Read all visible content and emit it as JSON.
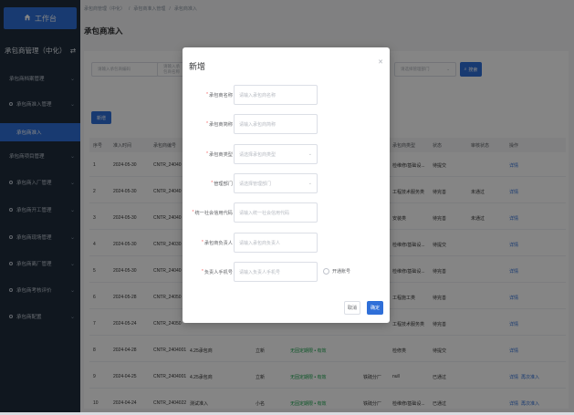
{
  "sidebar": {
    "home_icon": "home-icon",
    "home_label": "工作台",
    "section_title": "承包商管理（中化）",
    "section_toggle": "⇄",
    "items": [
      {
        "label": "承包商档案管理",
        "has_dot": false
      },
      {
        "label": "承包商准入管理",
        "has_dot": true
      },
      {
        "label": "承包商项目管理",
        "has_dot": false
      },
      {
        "label": "承包商入厂管理",
        "has_dot": true
      },
      {
        "label": "承包商开工管理",
        "has_dot": true
      },
      {
        "label": "承包商现场管理",
        "has_dot": true
      },
      {
        "label": "承包商离厂管理",
        "has_dot": true
      },
      {
        "label": "承包商考核评价",
        "has_dot": true
      },
      {
        "label": "承包商配置",
        "has_dot": true
      }
    ],
    "active_sub": "承包商准入"
  },
  "main": {
    "breadcrumb": [
      "承包商管理（中化）",
      "/",
      "承包商准入管理",
      "/",
      "承包商准入"
    ],
    "title": "承包商准入",
    "filters": {
      "code_placeholder": "请输入承包商编码",
      "name_placeholder": "请输入承包商名称",
      "dept_placeholder": "请选择管理部门",
      "search_label": "搜索"
    },
    "add_label": "新增",
    "table": {
      "headers": [
        "序号",
        "准入时间",
        "承包商编号",
        "",
        "",
        "",
        "",
        "承包商类型",
        "状态",
        "审核状态",
        "操作"
      ],
      "rows": [
        {
          "no": "1",
          "date": "2024-05-30",
          "code": "CNTR_24040",
          "name": "",
          "person": "",
          "contact": "",
          "dept": "",
          "type": "检维修/基础设...",
          "status": "待提交",
          "audit": "",
          "ops": [
            "详情"
          ]
        },
        {
          "no": "2",
          "date": "2024-05-30",
          "code": "CNTR_24040",
          "name": "",
          "person": "",
          "contact": "",
          "dept": "",
          "type": "工程技术服务类",
          "status": "待完善",
          "audit": "未通过",
          "ops": [
            "详情"
          ]
        },
        {
          "no": "3",
          "date": "2024-05-30",
          "code": "CNTR_24040",
          "name": "",
          "person": "",
          "contact": "",
          "dept": "",
          "type": "安装类",
          "status": "待完善",
          "audit": "未通过",
          "ops": [
            "详情"
          ]
        },
        {
          "no": "4",
          "date": "2024-05-30",
          "code": "CNTR_24030",
          "name": "",
          "person": "",
          "contact": "",
          "dept": "",
          "type": "检维修/基础设...",
          "status": "待提交",
          "audit": "",
          "ops": [
            "详情"
          ]
        },
        {
          "no": "5",
          "date": "2024-05-30",
          "code": "CNTR_24040",
          "name": "",
          "person": "",
          "contact": "",
          "dept": "",
          "type": "检维修/基础设...",
          "status": "待完善",
          "audit": "",
          "ops": [
            "详情"
          ]
        },
        {
          "no": "6",
          "date": "2024-05-28",
          "code": "CNTR_24050",
          "name": "",
          "person": "",
          "contact": "",
          "dept": "",
          "type": "工程施工类",
          "status": "待完善",
          "audit": "",
          "ops": [
            "详情"
          ]
        },
        {
          "no": "7",
          "date": "2024-05-24",
          "code": "CNTR_24050",
          "name": "",
          "person": "",
          "contact": "",
          "dept": "",
          "type": "工程技术服务类",
          "status": "待完善",
          "audit": "",
          "ops": [
            "详情"
          ]
        },
        {
          "no": "8",
          "date": "2024-04-28",
          "code": "CNTR_2404001",
          "name": "4.25承包商",
          "person": "立新",
          "contact": "无固定期限 • 有效",
          "dept": "",
          "type": "检修类",
          "status": "待提交",
          "audit": "",
          "ops": [
            "详情"
          ]
        },
        {
          "no": "9",
          "date": "2024-04-25",
          "code": "CNTR_2404001",
          "name": "4.25承包商",
          "person": "立新",
          "contact": "无固定期限 • 有效",
          "dept": "铁硫分厂",
          "type": "null",
          "status": "已通过",
          "audit": "",
          "ops": [
            "详情",
            "再次准入"
          ]
        },
        {
          "no": "10",
          "date": "2024-04-24",
          "code": "CNTR_2404022",
          "name": "测试准入",
          "person": "小名",
          "contact": "无固定期限 • 有效",
          "dept": "铁硫分厂",
          "type": "检维修/基础设...",
          "status": "已通过",
          "audit": "",
          "ops": [
            "详情",
            "再次准入"
          ]
        }
      ]
    }
  },
  "modal": {
    "title": "新增",
    "close_icon": "close-icon",
    "fields": [
      {
        "label": "承包商名称",
        "required": true,
        "placeholder": "请输入承包商名称",
        "select": false
      },
      {
        "label": "承包商简称",
        "required": true,
        "placeholder": "请输入承包商简称",
        "select": false
      },
      {
        "label": "承包商类型",
        "required": true,
        "placeholder": "请选择承包商类型",
        "select": true
      },
      {
        "label": "管理部门",
        "required": true,
        "placeholder": "请选择管理部门",
        "select": true
      },
      {
        "label": "统一社会信用代码",
        "required": true,
        "placeholder": "请输入统一社会信用代码",
        "select": false
      },
      {
        "label": "承包商负责人",
        "required": true,
        "placeholder": "请输入承包商负责人",
        "select": false
      },
      {
        "label": "负责人手机号",
        "required": true,
        "placeholder": "请输入负责人手机号",
        "select": false
      }
    ],
    "account_checkbox_label": "开通账号",
    "cancel_label": "取消",
    "confirm_label": "确定"
  }
}
